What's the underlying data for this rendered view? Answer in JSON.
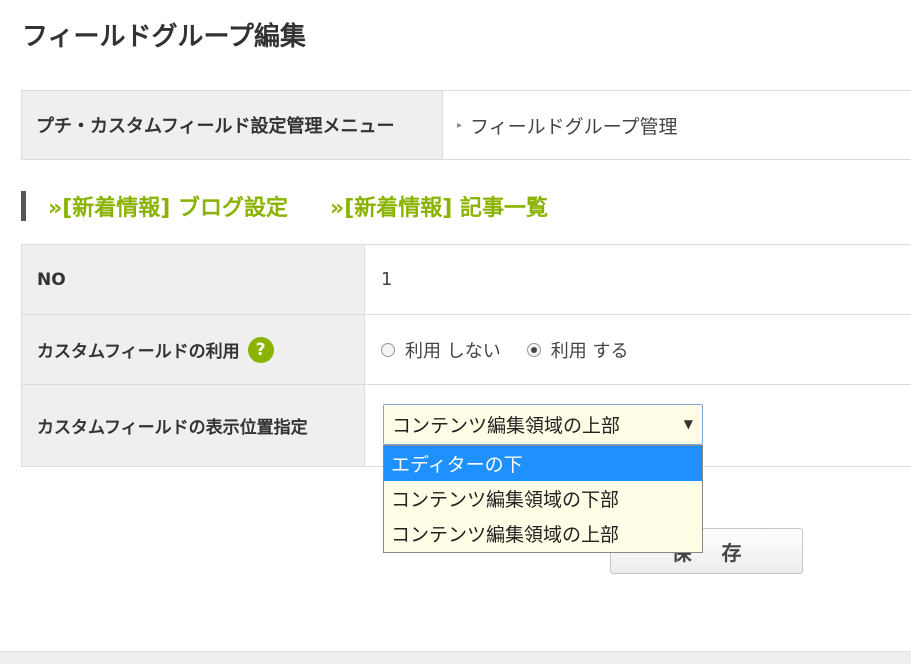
{
  "page": {
    "title": "フィールドグループ編集"
  },
  "menu": {
    "heading": "プチ・カスタムフィールド設定管理メニュー",
    "link": "フィールドグループ管理"
  },
  "quicklinks": [
    {
      "label": "»[新着情報] ブログ設定"
    },
    {
      "label": "»[新着情報] 記事一覧"
    }
  ],
  "form": {
    "no_label": "NO",
    "no_value": "1",
    "use_label": "カスタムフィールドの利用",
    "help_glyph": "?",
    "use_options": [
      {
        "label": "利用 しない",
        "checked": false
      },
      {
        "label": "利用 する",
        "checked": true
      }
    ],
    "position_label": "カスタムフィールドの表示位置指定",
    "position_selected": "コンテンツ編集領域の上部",
    "position_options": [
      {
        "label": "エディターの下",
        "highlighted": true
      },
      {
        "label": "コンテンツ編集領域の下部",
        "highlighted": false
      },
      {
        "label": "コンテンツ編集領域の上部",
        "highlighted": false
      }
    ]
  },
  "actions": {
    "save_label": "保存"
  },
  "icons": {
    "menu_arrow": "chevron-right-icon",
    "help": "help-icon",
    "caret": "caret-down-icon"
  },
  "colors": {
    "accent": "#8ab300",
    "highlight": "#1e90ff",
    "select_bg": "#fffde6"
  }
}
